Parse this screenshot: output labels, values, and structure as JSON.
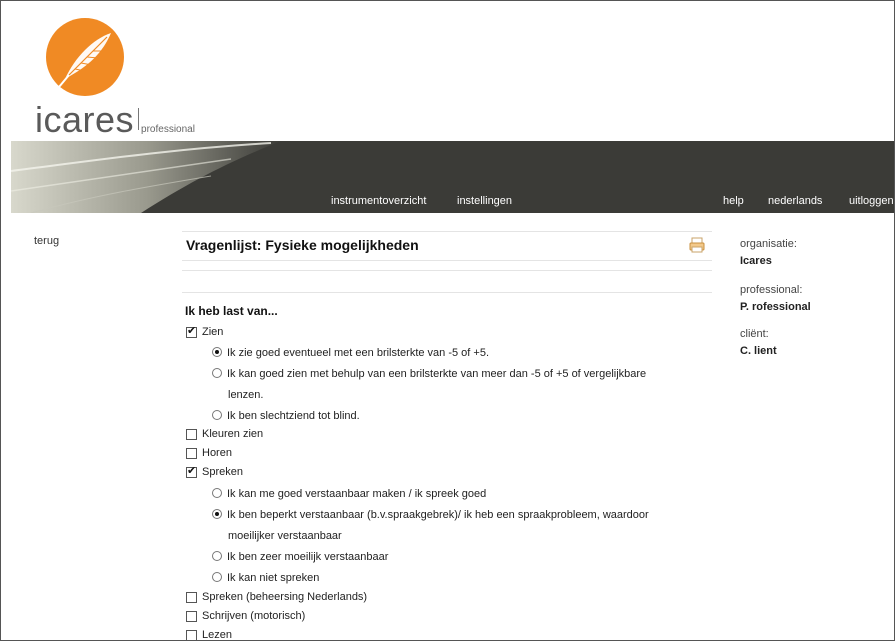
{
  "brand": {
    "name": "icares",
    "sub": "professional",
    "accent": "#f08a24"
  },
  "nav": {
    "instrumentoverzicht": "instrumentoverzicht",
    "instellingen": "instellingen",
    "help": "help",
    "language": "nederlands",
    "logout": "uitloggen"
  },
  "back_label": "terug",
  "page_title": "Vragenlijst: Fysieke mogelijkheden",
  "section_title": "Ik heb last van...",
  "questions": {
    "zien": {
      "label": "Zien",
      "checked": true,
      "options": [
        {
          "label": "Ik zie goed eventueel met een brilsterkte van -5 of +5.",
          "selected": true
        },
        {
          "label": "Ik kan goed zien met behulp van een brilsterkte van meer dan  -5 of +5 of vergelijkbare",
          "label2": "lenzen.",
          "selected": false
        },
        {
          "label": "Ik ben slechtziend tot blind.",
          "selected": false
        }
      ]
    },
    "kleuren": {
      "label": "Kleuren zien",
      "checked": false
    },
    "horen": {
      "label": "Horen",
      "checked": false
    },
    "spreken": {
      "label": "Spreken",
      "checked": true,
      "options": [
        {
          "label": "Ik kan me goed verstaanbaar maken / ik spreek goed",
          "selected": false
        },
        {
          "label": "Ik ben beperkt verstaanbaar (b.v.spraakgebrek)/ ik heb een spraakprobleem, waardoor",
          "label2": "moeilijker verstaanbaar",
          "selected": true
        },
        {
          "label": "Ik ben zeer moeilijk verstaanbaar",
          "selected": false
        },
        {
          "label": "Ik kan niet spreken",
          "selected": false
        }
      ]
    },
    "spreken_nl": {
      "label": "Spreken (beheersing Nederlands)",
      "checked": false
    },
    "schrijven": {
      "label": "Schrijven (motorisch)",
      "checked": false
    },
    "lezen": {
      "label": "Lezen",
      "checked": false
    }
  },
  "sidebar": {
    "organisatie_label": "organisatie:",
    "organisatie_value": "Icares",
    "professional_label": "professional:",
    "professional_value": "P. rofessional",
    "client_label": "cliënt:",
    "client_value": "C. lient"
  }
}
